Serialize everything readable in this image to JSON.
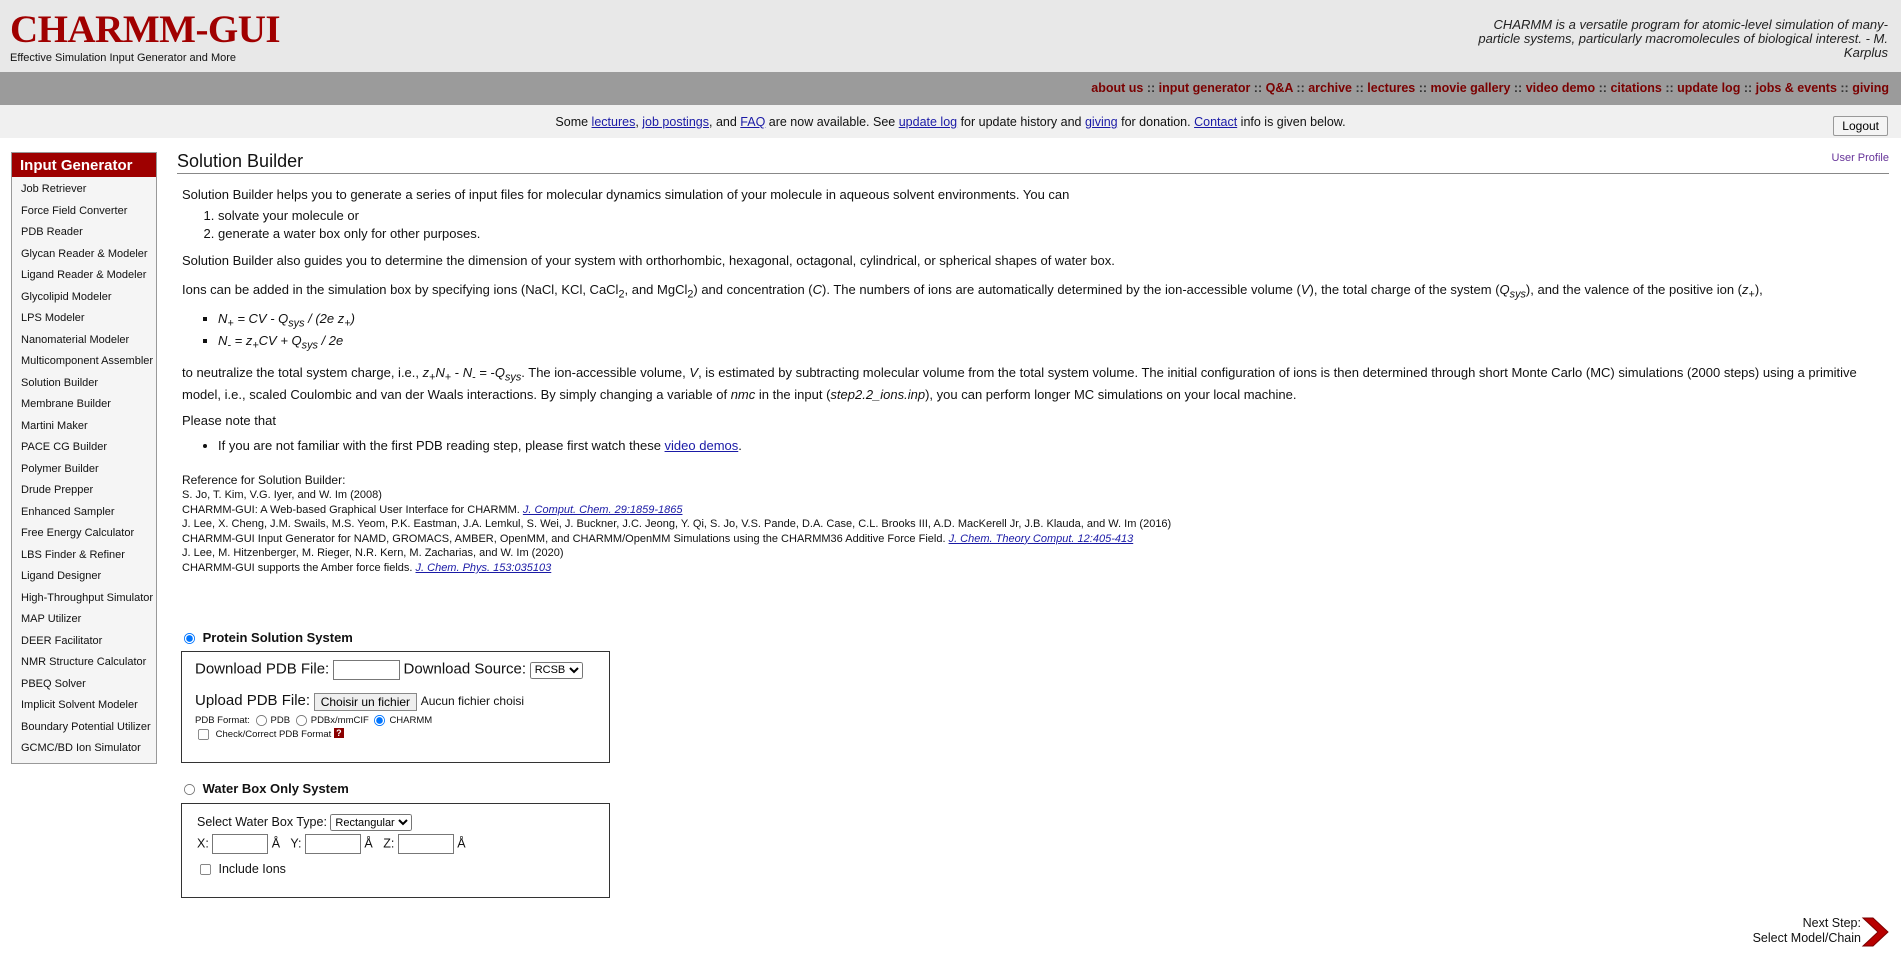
{
  "header": {
    "logo": "CHARMM-GUI",
    "tagline": "Effective Simulation Input Generator and More",
    "quote": "CHARMM is a versatile program for atomic-level simulation of many-particle systems, particularly macromolecules of biological interest. - M. Karplus"
  },
  "topnav": [
    {
      "label": "about us"
    },
    {
      "label": "input generator"
    },
    {
      "label": "Q&A"
    },
    {
      "label": "archive"
    },
    {
      "label": "lectures"
    },
    {
      "label": "movie gallery"
    },
    {
      "label": "video demo"
    },
    {
      "label": "citations"
    },
    {
      "label": "update log"
    },
    {
      "label": "jobs & events"
    },
    {
      "label": "giving"
    }
  ],
  "notice": {
    "t1": "Some ",
    "l1": "lectures",
    "t2": ", ",
    "l2": "job postings",
    "t3": ", and ",
    "l3": "FAQ",
    "t4": " are now available. See ",
    "l4": "update log",
    "t5": " for update history and ",
    "l5": "giving",
    "t6": " for donation. ",
    "l6": "Contact",
    "t7": " info is given below."
  },
  "logout_label": "Logout",
  "sidebar": {
    "title": "Input Generator",
    "items": [
      "Job Retriever",
      "Force Field Converter",
      "PDB Reader",
      "Glycan Reader & Modeler",
      "Ligand Reader & Modeler",
      "Glycolipid Modeler",
      "LPS Modeler",
      "Nanomaterial Modeler",
      "Multicomponent Assembler",
      "Solution Builder",
      "Membrane Builder",
      "Martini Maker",
      "PACE CG Builder",
      "Polymer Builder",
      "Drude Prepper",
      "Enhanced Sampler",
      "Free Energy Calculator",
      "LBS Finder & Refiner",
      "Ligand Designer",
      "High-Throughput Simulator",
      "MAP Utilizer",
      "DEER Facilitator",
      "NMR Structure Calculator",
      "PBEQ Solver",
      "Implicit Solvent Modeler",
      "Boundary Potential Utilizer",
      "GCMC/BD Ion Simulator"
    ]
  },
  "main": {
    "title": "Solution Builder",
    "user_profile": "User Profile",
    "intro": "Solution Builder helps you to generate a series of input files for molecular dynamics simulation of your molecule in aqueous solvent environments. You can",
    "intro_list": [
      "solvate your molecule or",
      "generate a water box only for other purposes."
    ],
    "dimension_text": "Solution Builder also guides you to determine the dimension of your system with orthorhombic, hexagonal, octagonal, cylindrical, or spherical shapes of water box.",
    "ions": {
      "a": "Ions can be added in the simulation box by specifying ions (NaCl, KCl, CaCl",
      "sub2a": "2",
      "b": ", and MgCl",
      "sub2b": "2",
      "c": ") and concentration (",
      "C": "C",
      "d": "). The numbers of ions are automatically determined by the ion-accessible volume (",
      "V": "V",
      "e": "), the total charge of the system (",
      "Q": "Q",
      "sys": "sys",
      "f": "), and the valence of the positive ion (",
      "z": "z",
      "plus": "+",
      "g": "),"
    },
    "formula1": {
      "N": "N",
      "plus": "+",
      "a": " = CV - Q",
      "sys": "sys",
      "b": " / (2e z",
      "plus2": "+",
      "c": ")"
    },
    "formula2": {
      "N": "N",
      "minus": "-",
      "a": " = z",
      "plus": "+",
      "b": "CV + Q",
      "sys": "sys",
      "c": " / 2e"
    },
    "neutralize": {
      "a": "to neutralize the total system charge, i.e., ",
      "z": "z",
      "plus": "+",
      "N1": "N",
      "plus2": "+",
      "b": " - ",
      "N2": "N",
      "minus": "-",
      "c": " = -",
      "Q": "Q",
      "sys": "sys",
      "d": ". The ion-accessible volume, ",
      "V": "V",
      "e": ", is estimated by subtracting molecular volume from the total system volume. The initial configuration of ions is then determined through short Monte Carlo (MC) simulations (2000 steps) using a primitive model, i.e., scaled Coulombic and van der Waals interactions. By simply changing a variable of ",
      "nmc": "nmc",
      "f": " in the input (",
      "inp": "step2.2_ions.inp",
      "g": "), you can perform longer MC simulations on your local machine."
    },
    "note": "Please note that",
    "note_item_text": "If you are not familiar with the first PDB reading step, please first watch these ",
    "note_item_link": "video demos",
    "note_item_end": ".",
    "references": {
      "heading": "Reference for Solution Builder:",
      "r1_authors": "S. Jo, T. Kim, V.G. Iyer, and W. Im (2008)",
      "r1_title": "CHARMM-GUI: A Web-based Graphical User Interface for CHARMM. ",
      "r1_link": "J. Comput. Chem. 29:1859-1865",
      "r2_authors": "J. Lee, X. Cheng, J.M. Swails, M.S. Yeom, P.K. Eastman, J.A. Lemkul, S. Wei, J. Buckner, J.C. Jeong, Y. Qi, S. Jo, V.S. Pande, D.A. Case, C.L. Brooks III, A.D. MacKerell Jr, J.B. Klauda, and W. Im (2016)",
      "r2_title": "CHARMM-GUI Input Generator for NAMD, GROMACS, AMBER, OpenMM, and CHARMM/OpenMM Simulations using the CHARMM36 Additive Force Field. ",
      "r2_link": "J. Chem. Theory Comput. 12:405-413",
      "r3_authors": "J. Lee, M. Hitzenberger, M. Rieger, N.R. Kern, M. Zacharias, and W. Im (2020)",
      "r3_title": "CHARMM-GUI supports the Amber force fields. ",
      "r3_link": "J. Chem. Phys. 153:035103"
    }
  },
  "protein_system": {
    "label": "Protein Solution System",
    "download_label": "Download PDB File:",
    "download_value": "",
    "source_label": "Download Source:",
    "source_selected": "RCSB",
    "upload_label": "Upload PDB File:",
    "file_button": "Choisir un fichier",
    "file_status": "Aucun fichier choisi",
    "format_label": "PDB Format:",
    "format_options": [
      "PDB",
      "PDBx/mmCIF",
      "CHARMM"
    ],
    "check_label": "Check/Correct PDB Format",
    "help_glyph": "?"
  },
  "water_system": {
    "label": "Water Box Only System",
    "type_label": "Select Water Box Type:",
    "type_selected": "Rectangular",
    "x_label": "X:",
    "y_label": "Y:",
    "z_label": "Z:",
    "unit": "Å",
    "x_value": "",
    "y_value": "",
    "z_value": "",
    "include_ions": "Include Ions"
  },
  "next_step": {
    "line1": "Next Step:",
    "line2": "Select Model/Chain"
  },
  "colors": {
    "brand_red": "#a00000",
    "nav_bar": "#9b9b9b",
    "link_blue": "#1a1aa6"
  }
}
